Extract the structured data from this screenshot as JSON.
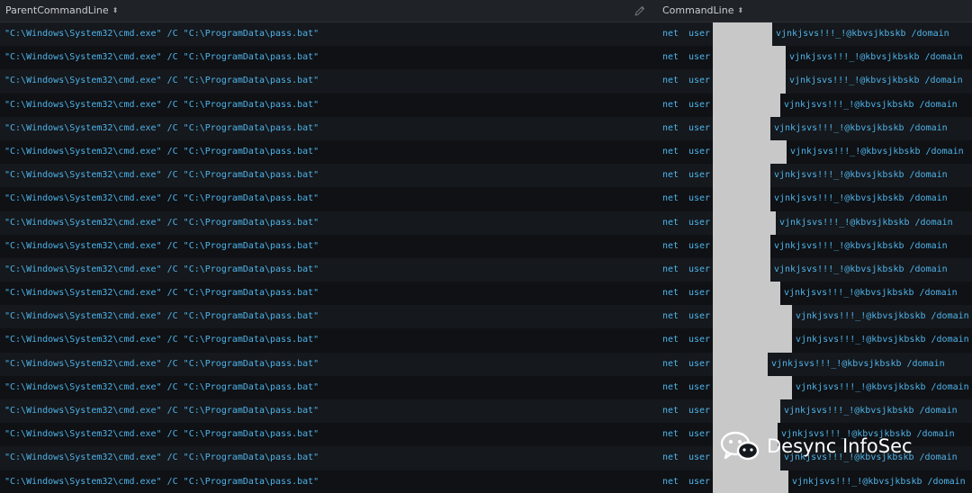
{
  "columns": {
    "parent": "ParentCommandLine",
    "command": "CommandLine",
    "sort_icon": "sort-arrows-icon",
    "edit_icon": "pencil-icon"
  },
  "rows": [
    {
      "parent": "\"C:\\Windows\\System32\\cmd.exe\" /C \"C:\\ProgramData\\pass.bat\"",
      "cmd_net": "net",
      "cmd_user": "user",
      "cmd_rest": "vjnkjsvs!!!_!@kbvsjkbskb /domain",
      "redact_end": 858
    },
    {
      "parent": "\"C:\\Windows\\System32\\cmd.exe\" /C \"C:\\ProgramData\\pass.bat\"",
      "cmd_net": "net",
      "cmd_user": "user",
      "cmd_rest": "vjnkjsvs!!!_!@kbvsjkbskb /domain",
      "redact_end": 873
    },
    {
      "parent": "\"C:\\Windows\\System32\\cmd.exe\" /C \"C:\\ProgramData\\pass.bat\"",
      "cmd_net": "net",
      "cmd_user": "user",
      "cmd_rest": "vjnkjsvs!!!_!@kbvsjkbskb /domain",
      "redact_end": 873
    },
    {
      "parent": "\"C:\\Windows\\System32\\cmd.exe\" /C \"C:\\ProgramData\\pass.bat\"",
      "cmd_net": "net",
      "cmd_user": "user",
      "cmd_rest": "vjnkjsvs!!!_!@kbvsjkbskb /domain",
      "redact_end": 867
    },
    {
      "parent": "\"C:\\Windows\\System32\\cmd.exe\" /C \"C:\\ProgramData\\pass.bat\"",
      "cmd_net": "net",
      "cmd_user": "user",
      "cmd_rest": "vjnkjsvs!!!_!@kbvsjkbskb /domain",
      "redact_end": 856
    },
    {
      "parent": "\"C:\\Windows\\System32\\cmd.exe\" /C \"C:\\ProgramData\\pass.bat\"",
      "cmd_net": "net",
      "cmd_user": "user",
      "cmd_rest": "vjnkjsvs!!!_!@kbvsjkbskb /domain",
      "redact_end": 874
    },
    {
      "parent": "\"C:\\Windows\\System32\\cmd.exe\" /C \"C:\\ProgramData\\pass.bat\"",
      "cmd_net": "net",
      "cmd_user": "user",
      "cmd_rest": "vjnkjsvs!!!_!@kbvsjkbskb /domain",
      "redact_end": 856
    },
    {
      "parent": "\"C:\\Windows\\System32\\cmd.exe\" /C \"C:\\ProgramData\\pass.bat\"",
      "cmd_net": "net",
      "cmd_user": "user",
      "cmd_rest": "vjnkjsvs!!!_!@kbvsjkbskb /domain",
      "redact_end": 856
    },
    {
      "parent": "\"C:\\Windows\\System32\\cmd.exe\" /C \"C:\\ProgramData\\pass.bat\"",
      "cmd_net": "net",
      "cmd_user": "user",
      "cmd_rest": "vjnkjsvs!!!_!@kbvsjkbskb /domain",
      "redact_end": 862
    },
    {
      "parent": "\"C:\\Windows\\System32\\cmd.exe\" /C \"C:\\ProgramData\\pass.bat\"",
      "cmd_net": "net",
      "cmd_user": "user",
      "cmd_rest": "vjnkjsvs!!!_!@kbvsjkbskb /domain",
      "redact_end": 856
    },
    {
      "parent": "\"C:\\Windows\\System32\\cmd.exe\" /C \"C:\\ProgramData\\pass.bat\"",
      "cmd_net": "net",
      "cmd_user": "user",
      "cmd_rest": "vjnkjsvs!!!_!@kbvsjkbskb /domain",
      "redact_end": 856
    },
    {
      "parent": "\"C:\\Windows\\System32\\cmd.exe\" /C \"C:\\ProgramData\\pass.bat\"",
      "cmd_net": "net",
      "cmd_user": "user",
      "cmd_rest": "vjnkjsvs!!!_!@kbvsjkbskb /domain",
      "redact_end": 867
    },
    {
      "parent": "\"C:\\Windows\\System32\\cmd.exe\" /C \"C:\\ProgramData\\pass.bat\"",
      "cmd_net": "net",
      "cmd_user": "user",
      "cmd_rest": "vjnkjsvs!!!_!@kbvsjkbskb /domain",
      "redact_end": 880
    },
    {
      "parent": "\"C:\\Windows\\System32\\cmd.exe\" /C \"C:\\ProgramData\\pass.bat\"",
      "cmd_net": "net",
      "cmd_user": "user",
      "cmd_rest": "vjnkjsvs!!!_!@kbvsjkbskb /domain",
      "redact_end": 880
    },
    {
      "parent": "\"C:\\Windows\\System32\\cmd.exe\" /C \"C:\\ProgramData\\pass.bat\"",
      "cmd_net": "net",
      "cmd_user": "user",
      "cmd_rest": "vjnkjsvs!!!_!@kbvsjkbskb /domain",
      "redact_end": 853
    },
    {
      "parent": "\"C:\\Windows\\System32\\cmd.exe\" /C \"C:\\ProgramData\\pass.bat\"",
      "cmd_net": "net",
      "cmd_user": "user",
      "cmd_rest": "vjnkjsvs!!!_!@kbvsjkbskb /domain",
      "redact_end": 880
    },
    {
      "parent": "\"C:\\Windows\\System32\\cmd.exe\" /C \"C:\\ProgramData\\pass.bat\"",
      "cmd_net": "net",
      "cmd_user": "user",
      "cmd_rest": "vjnkjsvs!!!_!@kbvsjkbskb /domain",
      "redact_end": 867
    },
    {
      "parent": "\"C:\\Windows\\System32\\cmd.exe\" /C \"C:\\ProgramData\\pass.bat\"",
      "cmd_net": "net",
      "cmd_user": "user",
      "cmd_rest": "vjnkjsvs!!!_!@kbvsjkbskb /domain",
      "redact_end": 864
    },
    {
      "parent": "\"C:\\Windows\\System32\\cmd.exe\" /C \"C:\\ProgramData\\pass.bat\"",
      "cmd_net": "net",
      "cmd_user": "user",
      "cmd_rest": "vjnkjsvs!!!_!@kbvsjkbskb /domain",
      "redact_end": 867
    },
    {
      "parent": "\"C:\\Windows\\System32\\cmd.exe\" /C \"C:\\ProgramData\\pass.bat\"",
      "cmd_net": "net",
      "cmd_user": "user",
      "cmd_rest": "vjnkjsvs!!!_!@kbvsjkbskb /domain",
      "redact_end": 876
    }
  ],
  "watermark": {
    "text": "Desync InfoSec",
    "icon": "wechat-logo-icon"
  }
}
